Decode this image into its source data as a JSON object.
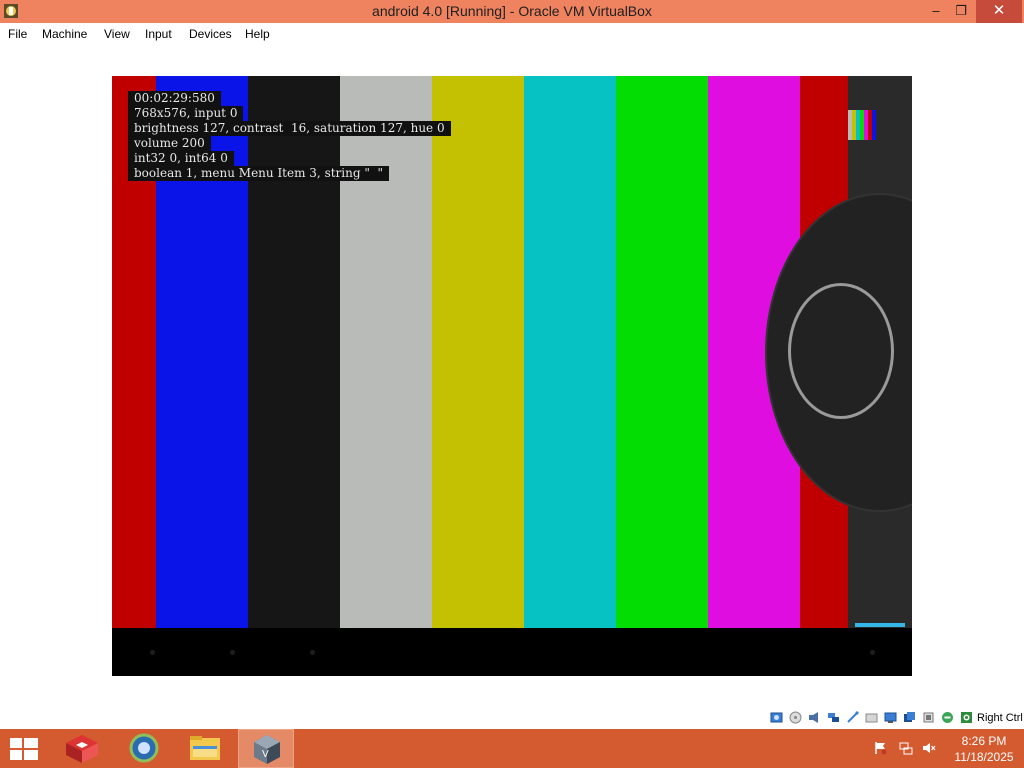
{
  "window": {
    "title": "android 4.0 [Running] - Oracle VM VirtualBox",
    "minimize_glyph": "‒",
    "maximize_glyph": "❐",
    "close_glyph": "✕"
  },
  "menu": {
    "items": [
      "File",
      "Machine",
      "View",
      "Input",
      "Devices",
      "Help"
    ]
  },
  "guest": {
    "osd_lines": [
      "00:02:29:580",
      "768x576, input 0",
      "brightness 127, contrast  16, saturation 127, hue 0",
      "volume 200",
      "int32 0, int64 0",
      "boolean 1, menu Menu Item 3, string \"  \""
    ],
    "color_bars": [
      {
        "color": "#c00000"
      },
      {
        "color": "#0a14e8"
      },
      {
        "color": "#161616"
      },
      {
        "color": "#b9bbb9"
      },
      {
        "color": "#c4c102"
      },
      {
        "color": "#06c2c2"
      },
      {
        "color": "#03dd03"
      },
      {
        "color": "#e00de0"
      },
      {
        "color": "#c00000"
      }
    ],
    "accent_color": "#33b5e5"
  },
  "statusbar": {
    "host_key_label": "Right Ctrl",
    "icons": [
      "hard-disk-icon",
      "optical-drive-icon",
      "audio-icon",
      "network-icon",
      "usb-icon",
      "shared-folders-icon",
      "display-icon",
      "video-capture-icon",
      "cpu-icon",
      "mouse-integration-icon",
      "keyboard-capture-icon"
    ]
  },
  "taskbar": {
    "apps": [
      "app-red-icon",
      "browser-icon",
      "file-explorer-icon",
      "virtualbox-icon"
    ],
    "active_app": "virtualbox-icon",
    "tray_icons": [
      "flag-icon",
      "network-icon",
      "volume-muted-icon"
    ],
    "time": "8:26 PM",
    "date": "11/18/2025"
  }
}
